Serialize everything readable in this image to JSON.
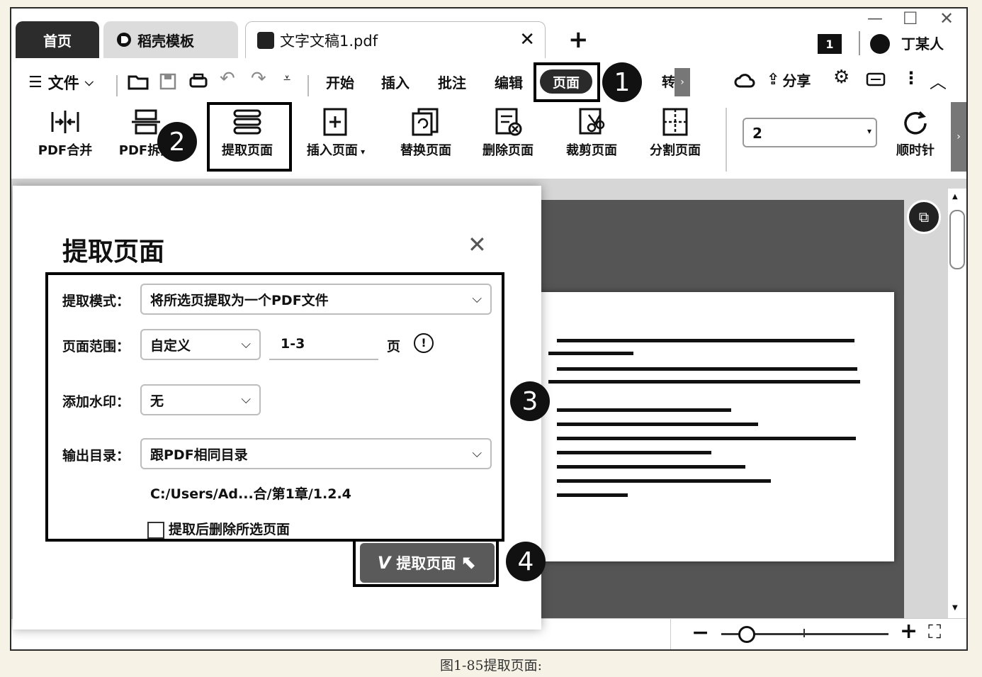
{
  "tabs": {
    "home": "首页",
    "template": "稻壳模板",
    "document": "文字文稿1.pdf",
    "add": "+"
  },
  "window": {
    "counter": "1",
    "user": "丁某人",
    "minimize": "—",
    "maximize": "☐",
    "close": "✕"
  },
  "menu": {
    "file": "文件",
    "items": [
      "开始",
      "插入",
      "批注",
      "编辑"
    ],
    "active": "页面",
    "cut": "转",
    "share": "分享"
  },
  "ribbon": {
    "merge": "PDF合并",
    "split": "PDF拆分",
    "extract": "提取页面",
    "insert": "插入页面",
    "replace": "替换页面",
    "delete": "删除页面",
    "crop": "裁剪页面",
    "divide": "分割页面",
    "page_value": "2",
    "rotate": "顺时针"
  },
  "dialog": {
    "title": "提取页面",
    "mode_label": "提取模式：",
    "mode_value": "将所选页提取为一个PDF文件",
    "range_label": "页面范围：",
    "range_value": "自定义",
    "range_input": "1-3",
    "range_unit": "页",
    "watermark_label": "添加水印：",
    "watermark_value": "无",
    "output_label": "输出目录：",
    "output_value": "跟PDF相同目录",
    "path": "C:/Users/Ad...合/第1章/1.2.4",
    "delete_checkbox": "提取后删除所选页面",
    "submit": "提取页面"
  },
  "badges": [
    "1",
    "2",
    "3",
    "4"
  ],
  "caption": "图1-85提取页面:"
}
